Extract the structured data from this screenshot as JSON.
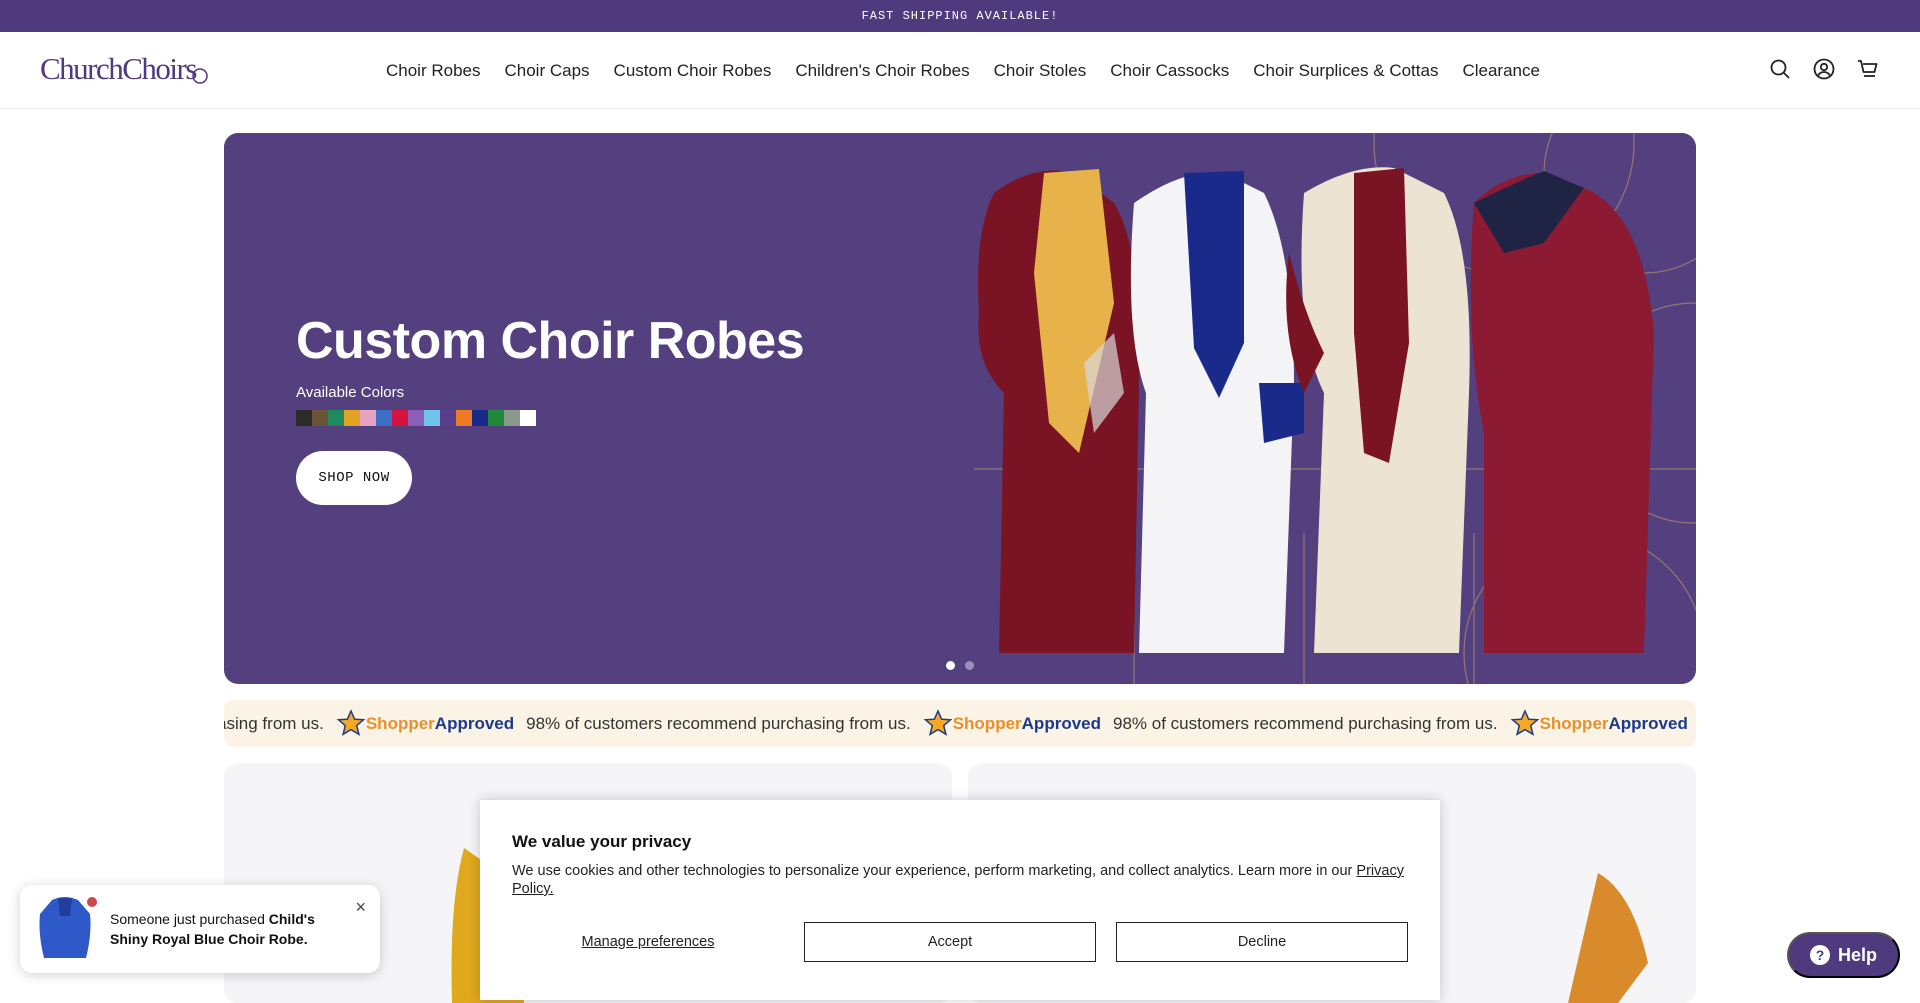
{
  "announcement": "FAST SHIPPING AVAILABLE!",
  "brand": {
    "name": "ChurchChoirs",
    "color": "#4f3a7d"
  },
  "nav": {
    "items": [
      "Choir Robes",
      "Choir Caps",
      "Custom Choir Robes",
      "Children's Choir Robes",
      "Choir Stoles",
      "Choir Cassocks",
      "Choir Surplices & Cottas",
      "Clearance"
    ]
  },
  "header_icons": [
    "search-icon",
    "account-icon",
    "cart-icon"
  ],
  "hero": {
    "title": "Custom Choir Robes",
    "colors_label": "Available Colors",
    "swatches": [
      "#2b2b2b",
      "#6b5436",
      "#1f8a5b",
      "#e2a322",
      "#e8a3c2",
      "#3a6fc4",
      "#d8123f",
      "#8b5fb8",
      "#6cc5e8",
      "#5a3d8c",
      "#ee7a24",
      "#1a2a8a",
      "#1f8a3a",
      "#8a9a8a",
      "#ffffff"
    ],
    "cta": "SHOP NOW",
    "background": "#54407f",
    "slides_total": 2,
    "active_slide": 1
  },
  "ticker": {
    "lead_fragment": "urchasing from us.",
    "message": "98% of customers recommend purchasing from us.",
    "logo_part1": "Shopper",
    "logo_part2": "Approved"
  },
  "cookie": {
    "title": "We value your privacy",
    "body": "We use cookies and other technologies to personalize your experience, perform marketing, and collect analytics. Learn more in our",
    "policy_link": "Privacy Policy.",
    "manage": "Manage preferences",
    "accept": "Accept",
    "decline": "Decline"
  },
  "toast": {
    "prefix": "Someone just purchased ",
    "product": "Child's Shiny Royal Blue Choir Robe.",
    "close": "×"
  },
  "help": {
    "label": "Help",
    "glyph": "?"
  }
}
